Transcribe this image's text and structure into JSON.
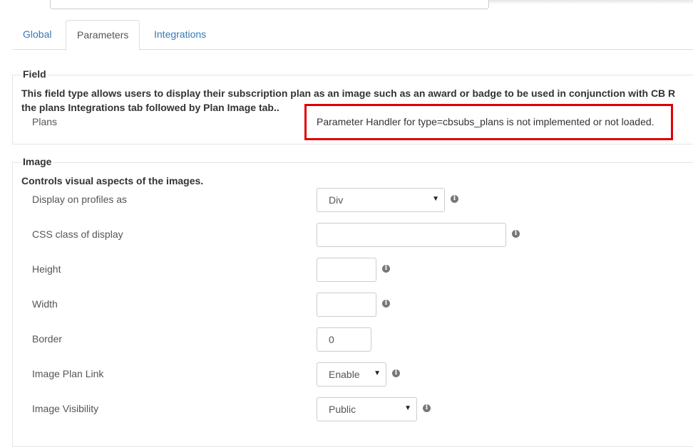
{
  "tabs": [
    "Global",
    "Parameters",
    "Integrations"
  ],
  "field_section": {
    "legend": "Field",
    "description_line1": "This field type allows users to display their subscription plan as an image such as an award or badge to be used in conjunction with CB R",
    "description_line2": "the plans Integrations tab followed by Plan Image tab..",
    "plans_label": "Plans",
    "error_message": "Parameter Handler for type=cbsubs_plans is not implemented or not loaded."
  },
  "image_section": {
    "legend": "Image",
    "description": "Controls visual aspects of the images.",
    "display_label": "Display on profiles as",
    "display_value": "Div",
    "css_class_label": "CSS class of display",
    "css_class_value": "",
    "height_label": "Height",
    "height_value": "",
    "width_label": "Width",
    "width_value": "",
    "border_label": "Border",
    "border_value": "0",
    "plan_link_label": "Image Plan Link",
    "plan_link_value": "Enable",
    "visibility_label": "Image Visibility",
    "visibility_value": "Public"
  },
  "icons": {
    "info": "info-icon",
    "caret": "caret-down-icon"
  },
  "colors": {
    "link": "#337ab7",
    "error_border": "#e00000",
    "info_icon": "#777777"
  }
}
